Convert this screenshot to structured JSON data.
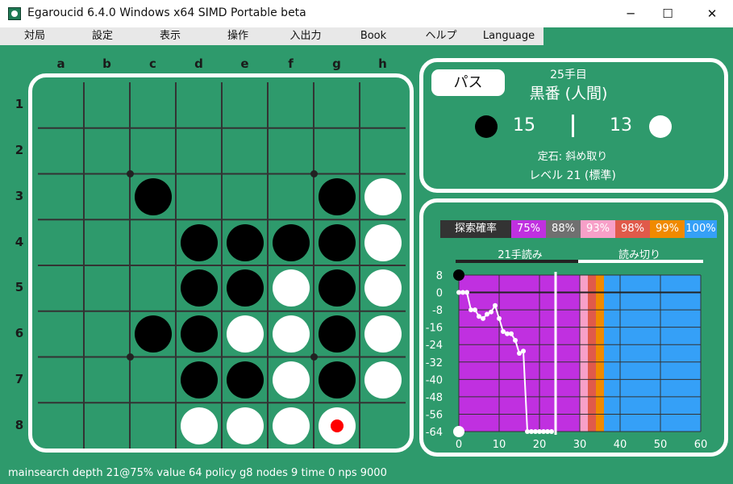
{
  "window": {
    "title": "Egaroucid 6.4.0 Windows x64 SIMD Portable beta",
    "minimize": "─",
    "maximize": "☐",
    "close": "✕"
  },
  "menu": [
    "対局",
    "設定",
    "表示",
    "操作",
    "入出力",
    "Book",
    "ヘルプ",
    "Language"
  ],
  "board": {
    "columns": [
      "a",
      "b",
      "c",
      "d",
      "e",
      "f",
      "g",
      "h"
    ],
    "rows": [
      "1",
      "2",
      "3",
      "4",
      "5",
      "6",
      "7",
      "8"
    ],
    "cells": [
      "........",
      "........",
      "..B...BW",
      "...BBBBW",
      "...BBWBW",
      "..BBWWBW",
      "...BBWBW",
      "...WWWW."
    ],
    "last_move": "g8",
    "colors": {
      "board": "#2e9a6c",
      "grid": "#333333",
      "marker": "#ff0000"
    }
  },
  "info": {
    "pass_label": "パス",
    "move_number": "25手目",
    "turn": "黒番 (人間)",
    "black_count": "15",
    "white_count": "13",
    "opening": "定石: 斜め取り",
    "level": "レベル 21 (標準)"
  },
  "graph": {
    "legend": {
      "label": "探索確率",
      "items": [
        {
          "text": "75%",
          "color": "#c030e0"
        },
        {
          "text": "88%",
          "color": "#707070"
        },
        {
          "text": "93%",
          "color": "#f7a0c8"
        },
        {
          "text": "98%",
          "color": "#e05a4a"
        },
        {
          "text": "99%",
          "color": "#f08a00"
        },
        {
          "text": "100%",
          "color": "#35a0f7"
        }
      ]
    },
    "read_label": "21手読み",
    "endgame_label": "読み切り",
    "yticks": [
      8,
      0,
      -8,
      -16,
      -24,
      -32,
      -40,
      -48,
      -56,
      -64
    ],
    "xticks": [
      0,
      10,
      20,
      30,
      40,
      50,
      60
    ],
    "ylim": [
      -64,
      8
    ],
    "xlim": [
      0,
      60
    ],
    "current_move": 24,
    "bands": [
      {
        "from": 0,
        "to": 30,
        "color": "#c030e0"
      },
      {
        "from": 30,
        "to": 32,
        "color": "#f7a0c8"
      },
      {
        "from": 32,
        "to": 34,
        "color": "#e05a4a"
      },
      {
        "from": 34,
        "to": 36,
        "color": "#f08a00"
      },
      {
        "from": 36,
        "to": 60,
        "color": "#35a0f7"
      }
    ],
    "series": [
      [
        0,
        0
      ],
      [
        1,
        0
      ],
      [
        2,
        0
      ],
      [
        3,
        -8
      ],
      [
        4,
        -8
      ],
      [
        5,
        -11
      ],
      [
        6,
        -12
      ],
      [
        7,
        -10
      ],
      [
        8,
        -9
      ],
      [
        9,
        -6
      ],
      [
        10,
        -12
      ],
      [
        11,
        -18
      ],
      [
        12,
        -19
      ],
      [
        13,
        -19
      ],
      [
        14,
        -22
      ],
      [
        15,
        -28
      ],
      [
        16,
        -27
      ],
      [
        17,
        -64
      ],
      [
        18,
        -64
      ],
      [
        19,
        -64
      ],
      [
        20,
        -64
      ],
      [
        21,
        -64
      ],
      [
        22,
        -64
      ],
      [
        23,
        -64
      ]
    ]
  },
  "status": "mainsearch depth 21@75% value 64 policy g8 nodes 9 time 0 nps 9000"
}
